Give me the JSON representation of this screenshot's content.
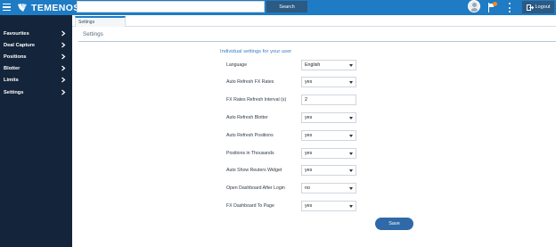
{
  "header": {
    "app_name": "TEMENOS",
    "search_placeholder": "",
    "search_button_label": "Search",
    "logout_label": "Logout",
    "accent_color": "#1e7bc4",
    "notification_color": "#f08a24"
  },
  "sidebar": {
    "items": [
      {
        "label": "Favourites"
      },
      {
        "label": "Deal Capture"
      },
      {
        "label": "Positions"
      },
      {
        "label": "Blotter"
      },
      {
        "label": "Limits"
      },
      {
        "label": "Settings"
      }
    ]
  },
  "tabs": [
    {
      "label": "Settings",
      "active": true
    }
  ],
  "page": {
    "title": "Settings",
    "section_title": "Individual settings for your user",
    "save_label": "Save",
    "rows": [
      {
        "label": "Language",
        "type": "select",
        "value": "English"
      },
      {
        "label": "Auto Refresh FX Rates",
        "type": "select",
        "value": "yes"
      },
      {
        "label": "FX Rates Refresh Interval (s)",
        "type": "input",
        "value": "2"
      },
      {
        "label": "Auto Refresh Blotter",
        "type": "select",
        "value": "yes"
      },
      {
        "label": "Auto Refresh Positions",
        "type": "select",
        "value": "yes"
      },
      {
        "label": "Positions in Thousands",
        "type": "select",
        "value": "yes"
      },
      {
        "label": "Auto Show Reuters Widget",
        "type": "select",
        "value": "yes"
      },
      {
        "label": "Open Dashboard After Login",
        "type": "select",
        "value": "no"
      },
      {
        "label": "FX Dashboard To Page",
        "type": "select",
        "value": "yes"
      }
    ]
  }
}
